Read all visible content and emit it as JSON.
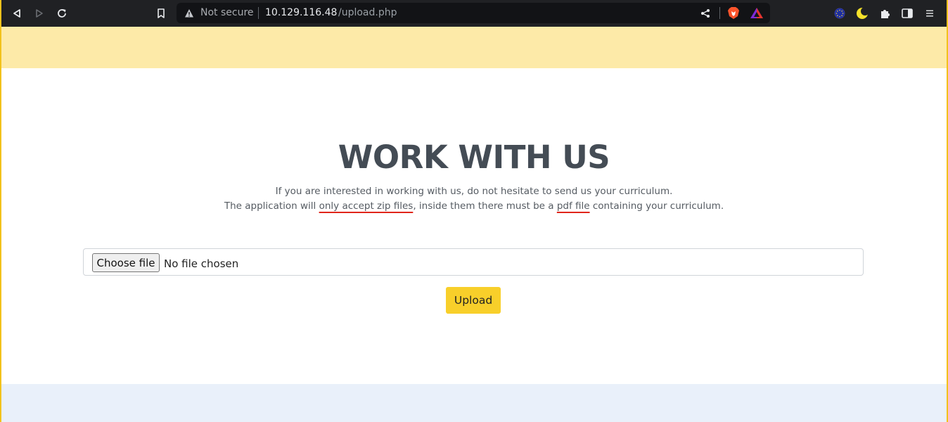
{
  "browser": {
    "security_label": "Not secure",
    "url_host": "10.129.116.48",
    "url_path": "/upload.php",
    "icons": [
      "back-icon",
      "forward-icon",
      "reload-icon",
      "bookmark-icon",
      "warning-icon",
      "share-icon",
      "brave-shield-icon",
      "brave-rewards-icon",
      "vpn-icon",
      "dark-mode-icon",
      "extensions-icon",
      "sidebar-icon",
      "menu-icon"
    ]
  },
  "page": {
    "title": "WORK WITH US",
    "description_line1": "If you are interested in working with us, do not hesitate to send us your curriculum.",
    "description_line2_part1": "The application will ",
    "description_line2_highlight1": "only accept zip files",
    "description_line2_part2": ", inside them there must be a ",
    "description_line2_highlight2": "pdf file",
    "description_line2_part3": " containing your curriculum."
  },
  "form": {
    "choose_file_label": "Choose file",
    "file_status": "No file chosen",
    "upload_label": "Upload"
  },
  "colors": {
    "accent": "#f8cf2a",
    "top_band": "#fdeaa8",
    "bottom_band": "#e9f0fa",
    "underline": "#e0261b"
  }
}
